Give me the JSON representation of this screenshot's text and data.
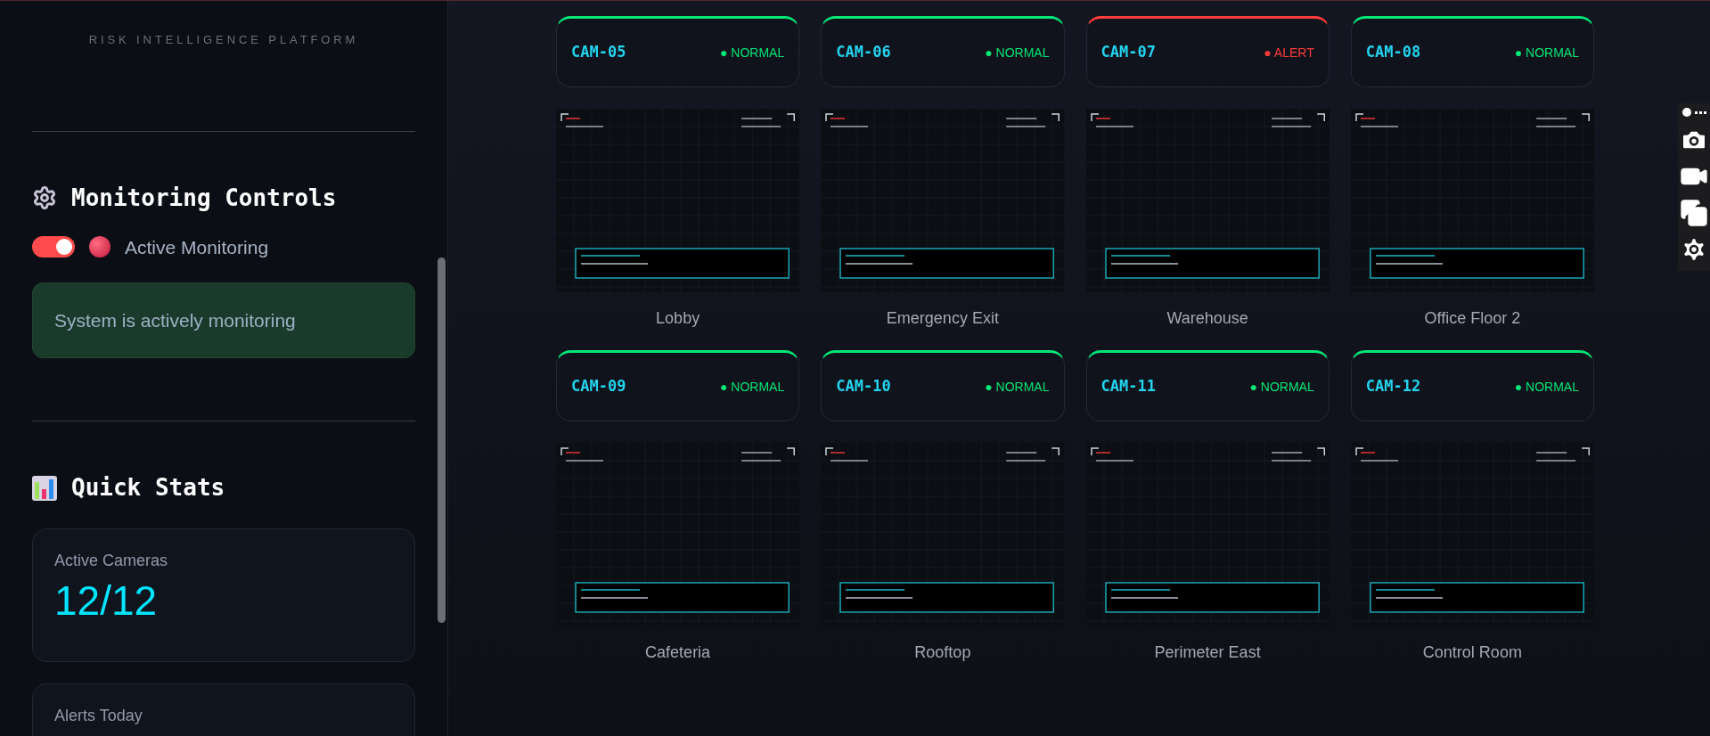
{
  "sidebar": {
    "subtitle": "RISK INTELLIGENCE PLATFORM",
    "monitoring": {
      "heading": "Monitoring Controls",
      "toggle": {
        "label": "Active Monitoring",
        "on": true
      },
      "status_message": "System is actively monitoring"
    },
    "quick_stats": {
      "heading": "Quick Stats",
      "cards": [
        {
          "label": "Active Cameras",
          "value": "12/12"
        },
        {
          "label": "Alerts Today"
        }
      ]
    }
  },
  "cameras": [
    {
      "id": "CAM-05",
      "status": "● NORMAL",
      "color": "#00e676",
      "location": "Lobby"
    },
    {
      "id": "CAM-06",
      "status": "● NORMAL",
      "color": "#00e676",
      "location": "Emergency Exit"
    },
    {
      "id": "CAM-07",
      "status": "● ALERT",
      "color": "#ff3b3b",
      "location": "Warehouse"
    },
    {
      "id": "CAM-08",
      "status": "● NORMAL",
      "color": "#00e676",
      "location": "Office Floor 2"
    },
    {
      "id": "CAM-09",
      "status": "● NORMAL",
      "color": "#00e676",
      "location": "Cafeteria"
    },
    {
      "id": "CAM-10",
      "status": "● NORMAL",
      "color": "#00e676",
      "location": "Rooftop"
    },
    {
      "id": "CAM-11",
      "status": "● NORMAL",
      "color": "#00e676",
      "location": "Perimeter East"
    },
    {
      "id": "CAM-12",
      "status": "● NORMAL",
      "color": "#00e676",
      "location": "Control Room"
    }
  ]
}
